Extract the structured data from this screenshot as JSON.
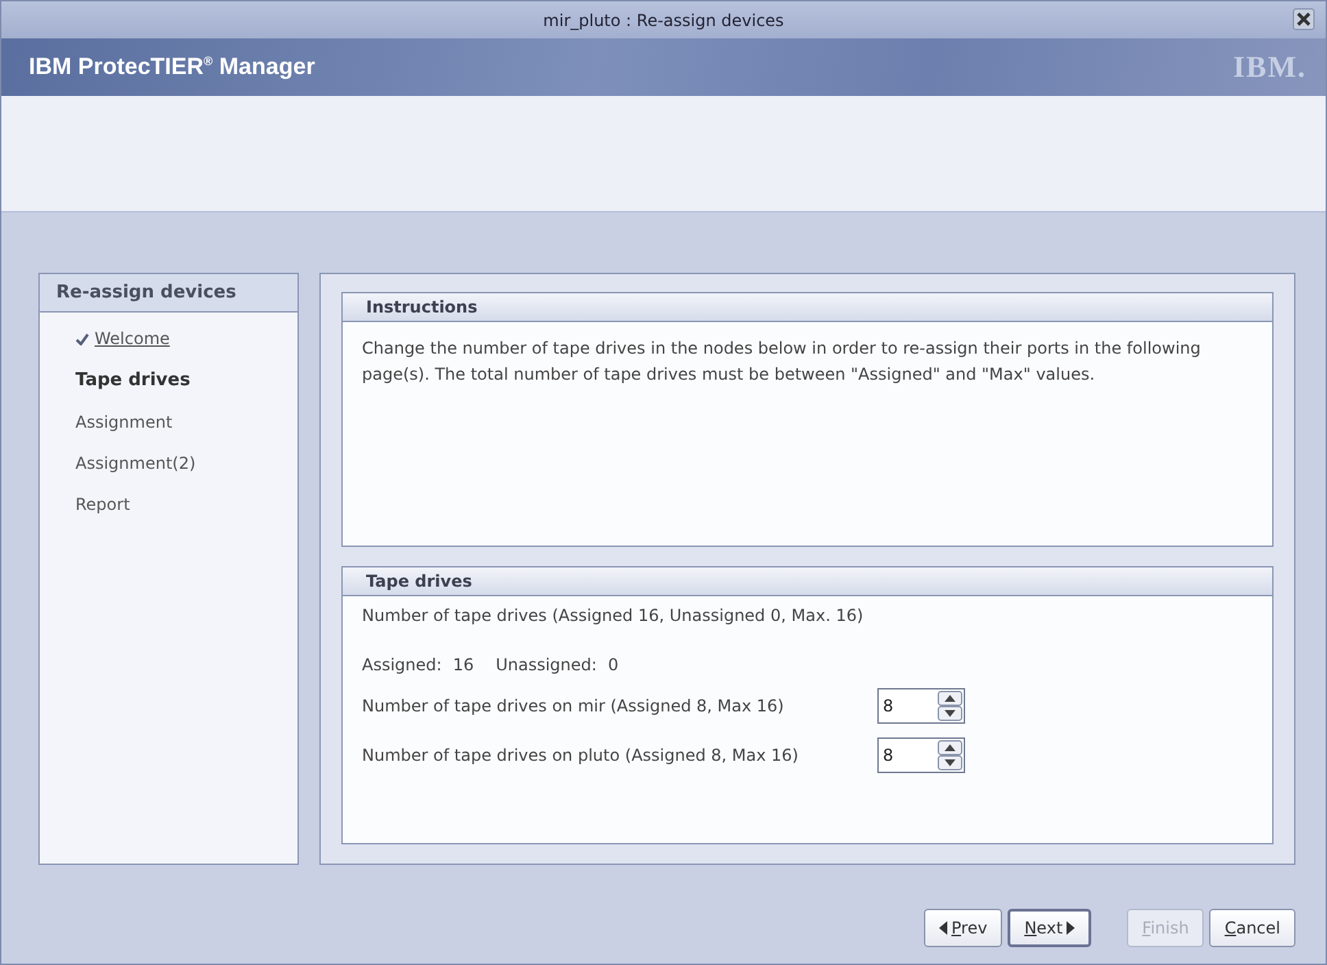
{
  "window": {
    "title": "mir_pluto : Re-assign devices"
  },
  "header": {
    "product": "IBM ProtecTIER",
    "mark": "®",
    "suffix": " Manager",
    "logo": "IBM."
  },
  "sidebar": {
    "title": "Re-assign devices",
    "steps": [
      {
        "label": "Welcome",
        "kind": "done"
      },
      {
        "label": "Tape drives",
        "kind": "current"
      },
      {
        "label": "Assignment",
        "kind": "pending"
      },
      {
        "label": "Assignment(2)",
        "kind": "pending"
      },
      {
        "label": "Report",
        "kind": "pending"
      }
    ]
  },
  "instructions": {
    "title": "Instructions",
    "text": "Change the number of tape drives in the nodes below in order to re-assign their ports in the following page(s). The total number of tape drives must be between \"Assigned\" and \"Max\" values."
  },
  "tape_drives": {
    "title": "Tape drives",
    "summary": "Number of tape drives (Assigned 16, Unassigned 0, Max. 16)",
    "assigned_label": "Assigned:",
    "assigned_value": "16",
    "unassigned_label": "Unassigned:",
    "unassigned_value": "0",
    "nodes": [
      {
        "label": "Number of tape drives on mir (Assigned 8, Max 16)",
        "value": "8"
      },
      {
        "label": "Number of tape drives on pluto (Assigned 8, Max 16)",
        "value": "8"
      }
    ]
  },
  "buttons": [
    {
      "label": "Prev",
      "kind": "back",
      "disabled": false,
      "default": false
    },
    {
      "label": "Next",
      "kind": "forward",
      "disabled": false,
      "default": true
    },
    {
      "label": "Finish",
      "kind": "plain",
      "disabled": true,
      "default": false
    },
    {
      "label": "Cancel",
      "kind": "plain",
      "disabled": false,
      "default": false
    }
  ]
}
